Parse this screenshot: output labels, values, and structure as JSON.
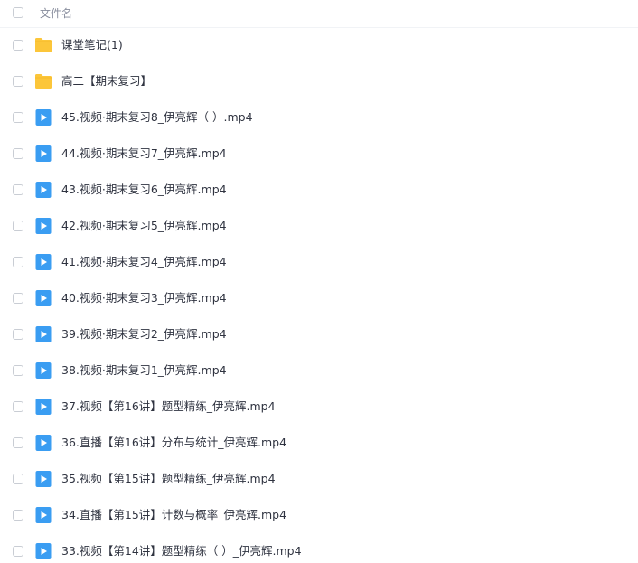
{
  "header": {
    "column_label": "文件名"
  },
  "files": [
    {
      "name": "课堂笔记(1)",
      "icon": "folder-icon"
    },
    {
      "name": "高二【期末复习】",
      "icon": "folder-icon"
    },
    {
      "name": "45.视频·期末复习8_伊亮辉（ ）.mp4",
      "icon": "video-file-icon"
    },
    {
      "name": "44.视频·期末复习7_伊亮辉.mp4",
      "icon": "video-file-icon"
    },
    {
      "name": "43.视频·期末复习6_伊亮辉.mp4",
      "icon": "video-file-icon"
    },
    {
      "name": "42.视频·期末复习5_伊亮辉.mp4",
      "icon": "video-file-icon"
    },
    {
      "name": "41.视频·期末复习4_伊亮辉.mp4",
      "icon": "video-file-icon"
    },
    {
      "name": "40.视频·期末复习3_伊亮辉.mp4",
      "icon": "video-file-icon"
    },
    {
      "name": "39.视频·期末复习2_伊亮辉.mp4",
      "icon": "video-file-icon"
    },
    {
      "name": "38.视频·期末复习1_伊亮辉.mp4",
      "icon": "video-file-icon"
    },
    {
      "name": "37.视频【第16讲】题型精练_伊亮辉.mp4",
      "icon": "video-file-icon"
    },
    {
      "name": "36.直播【第16讲】分布与统计_伊亮辉.mp4",
      "icon": "video-file-icon"
    },
    {
      "name": "35.视频【第15讲】题型精练_伊亮辉.mp4",
      "icon": "video-file-icon"
    },
    {
      "name": "34.直播【第15讲】计数与概率_伊亮辉.mp4",
      "icon": "video-file-icon"
    },
    {
      "name": "33.视频【第14讲】题型精练（ ）_伊亮辉.mp4",
      "icon": "video-file-icon"
    }
  ],
  "colors": {
    "folder": "#fcc63a",
    "folder_tab": "#f2b01e",
    "video": "#3a9df2",
    "header_text": "#878c9c",
    "row_text": "#2f3340"
  }
}
